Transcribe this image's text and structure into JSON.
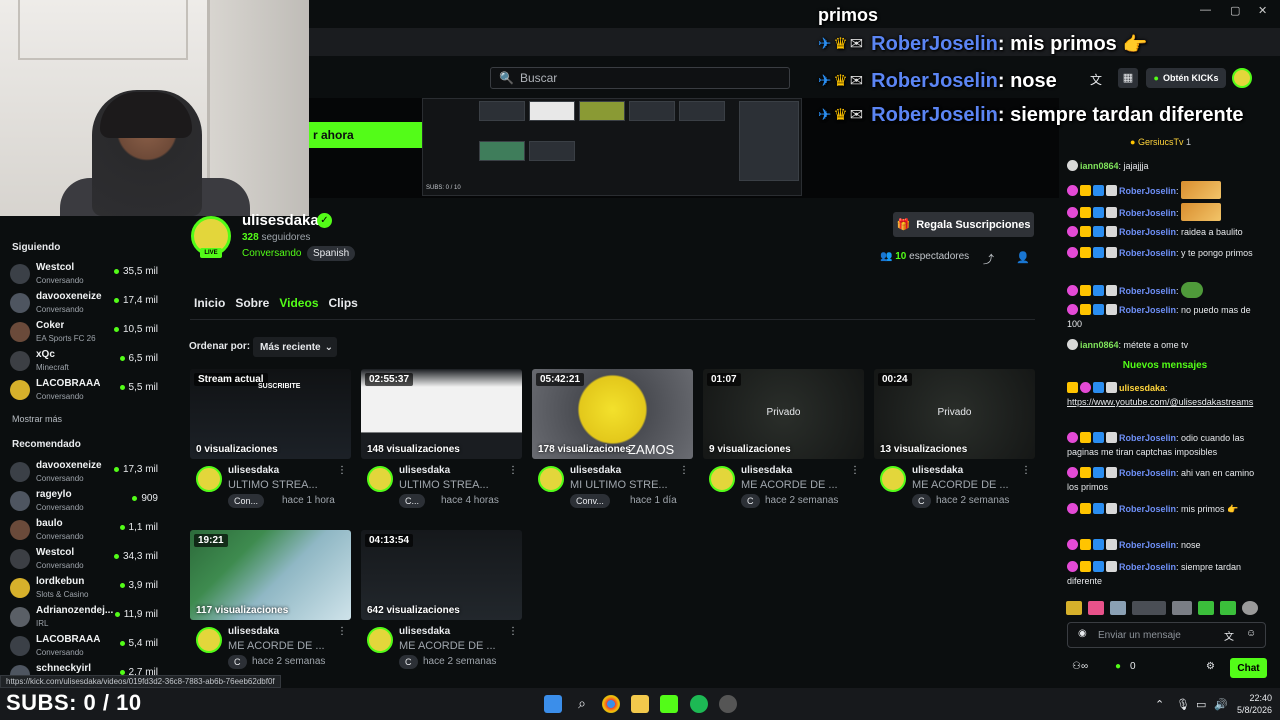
{
  "overlay": {
    "top_text": "primos",
    "lines": [
      {
        "user": "RoberJoselin",
        "message": "mis primos"
      },
      {
        "user": "RoberJoselin",
        "message": "nose"
      },
      {
        "user": "RoberJoselin",
        "message": "siempre tardan diferente"
      }
    ]
  },
  "header": {
    "search_placeholder": "Buscar",
    "kicks_button": "Obtén KICKs",
    "banner_button": "r ahora",
    "banner_sub_text": "SUBS: 0 / 10"
  },
  "channel": {
    "name": "ulisesdaka",
    "followers_count": "328",
    "followers_label": "seguidores",
    "category": "Conversando",
    "language_tag": "Spanish",
    "live_badge": "LIVE",
    "gift_button": "Regala Suscripciones",
    "viewers_count": "10",
    "viewers_label": "espectadores"
  },
  "tabs": [
    "Inicio",
    "Sobre",
    "Videos",
    "Clips"
  ],
  "sort": {
    "label": "Ordenar por:",
    "value": "Más reciente"
  },
  "videos": [
    {
      "badge": "Stream actual",
      "views": "0 visualizaciones",
      "user": "ulisesdaka",
      "title": "ULTIMO STREA...",
      "chip": "Con...",
      "time": "hace 1 hora"
    },
    {
      "badge": "02:55:37",
      "views": "148 visualizaciones",
      "user": "ulisesdaka",
      "title": "ULTIMO STREA...",
      "chip": "C...",
      "time": "hace 4 horas"
    },
    {
      "badge": "05:42:21",
      "views": "178 visualizaciones",
      "user": "ulisesdaka",
      "title": "MI ULTIMO STRE...",
      "chip": "Conv...",
      "time": "hace 1 día"
    },
    {
      "badge": "01:07",
      "views": "9 visualizaciones",
      "private": "Privado",
      "user": "ulisesdaka",
      "title": "ME ACORDE DE ...",
      "chip": "C",
      "time": "hace 2 semanas"
    },
    {
      "badge": "00:24",
      "views": "13 visualizaciones",
      "private": "Privado",
      "user": "ulisesdaka",
      "title": "ME ACORDE DE ...",
      "chip": "C",
      "time": "hace 2 semanas"
    },
    {
      "badge": "19:21",
      "views": "117 visualizaciones",
      "user": "ulisesdaka",
      "title": "ME ACORDE DE ...",
      "chip": "C",
      "time": "hace 2 semanas"
    },
    {
      "badge": "04:13:54",
      "views": "642 visualizaciones",
      "user": "ulisesdaka",
      "title": "ME ACORDE DE ...",
      "chip": "C",
      "time": "hace 2 semanas"
    }
  ],
  "thumb_texts": {
    "suscribite": "SUSCRIBITE",
    "vamos": "ZAMOS"
  },
  "sidebar": {
    "following_title": "Siguiendo",
    "following": [
      {
        "name": "Westcol",
        "category": "Conversando",
        "viewers": "35,5 mil"
      },
      {
        "name": "davooxeneize",
        "category": "Conversando",
        "viewers": "17,4 mil"
      },
      {
        "name": "Coker",
        "category": "EA Sports FC 26",
        "viewers": "10,5 mil"
      },
      {
        "name": "xQc",
        "category": "Minecraft",
        "viewers": "6,5 mil"
      },
      {
        "name": "LACOBRAAA",
        "category": "Conversando",
        "viewers": "5,5 mil"
      }
    ],
    "show_more": "Mostrar más",
    "recommended_title": "Recomendado",
    "recommended": [
      {
        "name": "davooxeneize",
        "category": "Conversando",
        "viewers": "17,3 mil"
      },
      {
        "name": "rageylo",
        "category": "Conversando",
        "viewers": "909"
      },
      {
        "name": "baulo",
        "category": "Conversando",
        "viewers": "1,1 mil"
      },
      {
        "name": "Westcol",
        "category": "Conversando",
        "viewers": "34,3 mil"
      },
      {
        "name": "lordkebun",
        "category": "Slots & Casino",
        "viewers": "3,9 mil"
      },
      {
        "name": "Adrianozendej...",
        "category": "IRL",
        "viewers": "11,9 mil"
      },
      {
        "name": "LACOBRAAA",
        "category": "Conversando",
        "viewers": "5,4 mil"
      },
      {
        "name": "schneckyirl",
        "category": "",
        "viewers": "2,7 mil"
      }
    ]
  },
  "chat": {
    "pinned_user": "GersiucsTv",
    "pinned_count": "1",
    "messages_before": [
      {
        "user": "iann0864",
        "text": "jajajjja",
        "style": "green"
      },
      {
        "user": "RoberJoselin",
        "text": "",
        "emote": true
      },
      {
        "user": "RoberJoselin",
        "text": "",
        "emote": true
      },
      {
        "user": "RoberJoselin",
        "text": "raidea a baulito"
      },
      {
        "user": "RoberJoselin",
        "text": "y te pongo primos"
      },
      {
        "user": "RoberJoselin",
        "text": "",
        "pepe": true
      },
      {
        "user": "RoberJoselin",
        "text": "no puedo mas de 100"
      },
      {
        "user": "iann0864",
        "text": "métete a ome tv",
        "style": "green"
      }
    ],
    "new_messages": "Nuevos mensajes",
    "messages_after": [
      {
        "user": "ulisesdaka",
        "text": "https://www.youtube.com/@ulisesdakastreams",
        "style": "gold",
        "link": true
      },
      {
        "user": "RoberJoselin",
        "text": "odio cuando las paginas me tiran captchas imposibles"
      },
      {
        "user": "RoberJoselin",
        "text": "ahi van en camino los primos"
      },
      {
        "user": "RoberJoselin",
        "text": "mis primos 👉"
      },
      {
        "user": "RoberJoselin",
        "text": "nose"
      },
      {
        "user": "RoberJoselin",
        "text": "siempre tardan diferente"
      }
    ],
    "input_placeholder": "Enviar un mensaje",
    "kicks_balance": "0",
    "send_button": "Chat"
  },
  "status_link": "https://kick.com/ulisesdaka/videos/019fd3d2-36c8-7883-ab6b-76eeb62dbf0f",
  "subs_overlay": "SUBS: 0 / 10",
  "taskbar": {
    "time": "22:40",
    "date": "5/8/2026"
  }
}
